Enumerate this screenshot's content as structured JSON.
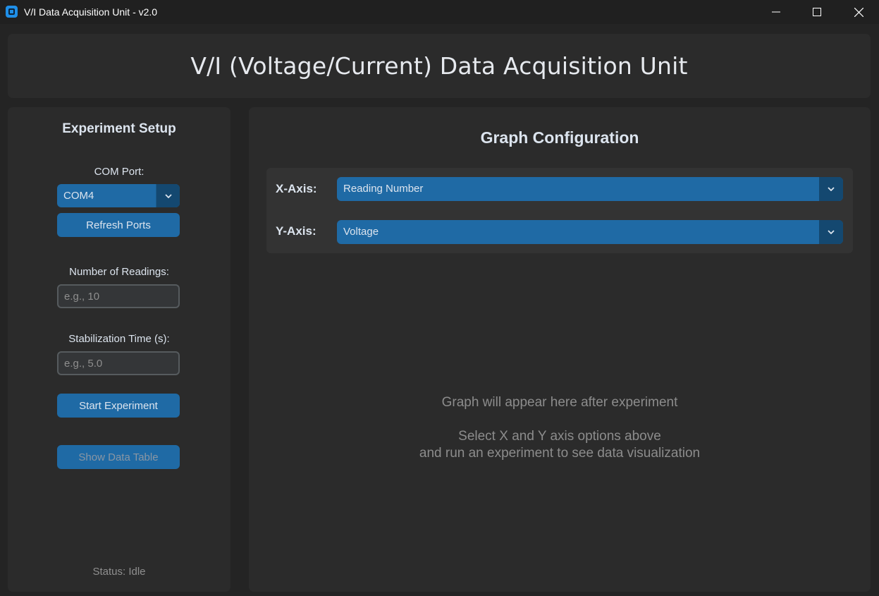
{
  "window": {
    "title": "V/I Data Acquisition Unit - v2.0"
  },
  "header": {
    "title": "V/I (Voltage/Current) Data Acquisition Unit"
  },
  "setup": {
    "title": "Experiment Setup",
    "com_port_label": "COM Port:",
    "com_port_value": "COM4",
    "refresh_label": "Refresh Ports",
    "readings_label": "Number of Readings:",
    "readings_placeholder": "e.g., 10",
    "stabilization_label": "Stabilization Time (s):",
    "stabilization_placeholder": "e.g., 5.0",
    "start_label": "Start Experiment",
    "show_table_label": "Show Data Table",
    "status": "Status: Idle"
  },
  "graph": {
    "title": "Graph Configuration",
    "x_axis_label": "X-Axis:",
    "x_axis_value": "Reading Number",
    "y_axis_label": "Y-Axis:",
    "y_axis_value": "Voltage",
    "placeholder_line1": "Graph will appear here after experiment",
    "placeholder_line2": "Select X and Y axis options above",
    "placeholder_line3": "and run an experiment to see data visualization"
  },
  "colors": {
    "accent": "#1f6aa5",
    "accent_dark": "#144870",
    "panel": "#2b2b2b",
    "background": "#242424"
  }
}
